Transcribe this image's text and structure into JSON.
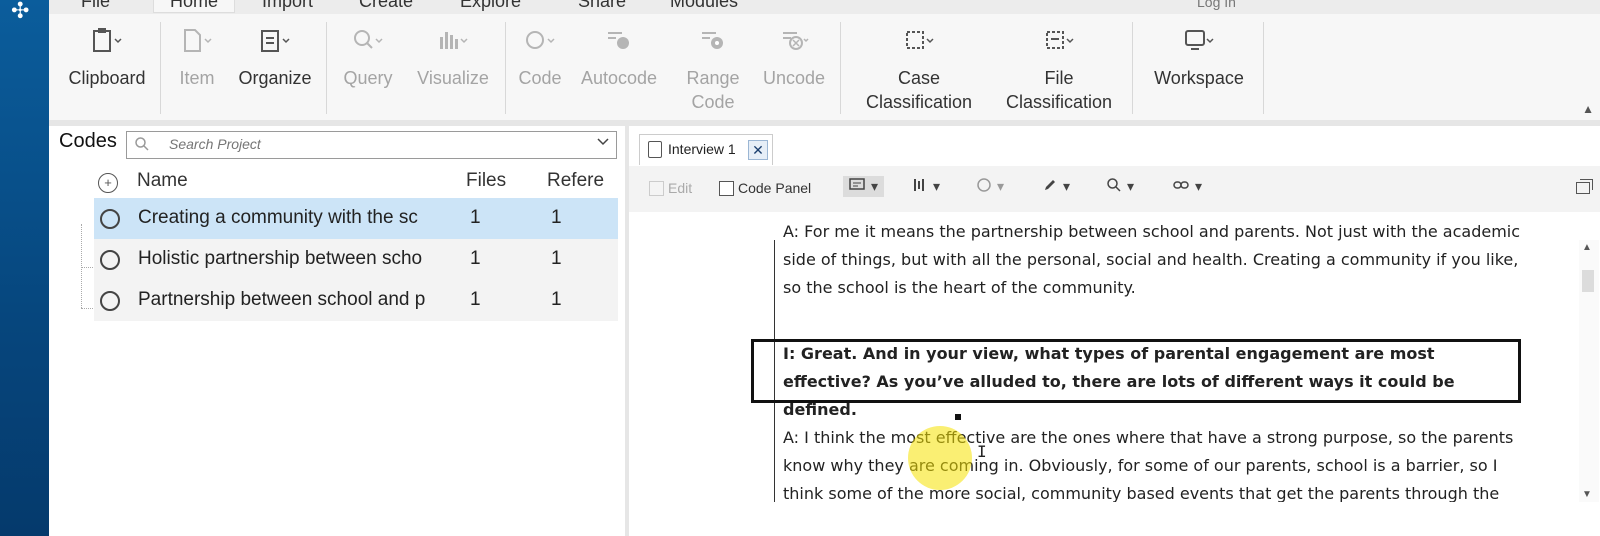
{
  "menu": {
    "items": [
      "File",
      "Home",
      "Import",
      "Create",
      "Explore",
      "Share",
      "Modules"
    ],
    "active": "Home",
    "login": "Log In"
  },
  "ribbon": {
    "groups": [
      {
        "label": "Clipboard",
        "icon": "clipboard-icon",
        "enabled": true
      },
      {
        "label": "Item",
        "icon": "item-icon",
        "enabled": false
      },
      {
        "label": "Organize",
        "icon": "organize-icon",
        "enabled": true
      },
      {
        "label": "Query",
        "icon": "query-icon",
        "enabled": false
      },
      {
        "label": "Visualize",
        "icon": "visualize-icon",
        "enabled": false
      },
      {
        "label": "Code",
        "icon": "code-icon",
        "enabled": false
      },
      {
        "label": "Autocode",
        "icon": "autocode-icon",
        "enabled": false
      },
      {
        "label": "Range Code",
        "icon": "range-code-icon",
        "enabled": false
      },
      {
        "label": "Uncode",
        "icon": "uncode-icon",
        "enabled": false
      },
      {
        "label": "Case Classification",
        "icon": "case-classification-icon",
        "enabled": true
      },
      {
        "label": "File Classification",
        "icon": "file-classification-icon",
        "enabled": true
      },
      {
        "label": "Workspace",
        "icon": "workspace-icon",
        "enabled": true
      }
    ]
  },
  "codes": {
    "title": "Codes",
    "search_placeholder": "Search Project",
    "columns": {
      "name": "Name",
      "files": "Files",
      "refs": "Refere"
    },
    "rows": [
      {
        "name": "Creating a community with the sc",
        "files": "1",
        "refs": "1",
        "selected": true
      },
      {
        "name": "Holistic partnership between scho",
        "files": "1",
        "refs": "1",
        "selected": false
      },
      {
        "name": "Partnership between school and p",
        "files": "1",
        "refs": "1",
        "selected": false
      }
    ]
  },
  "document": {
    "tab_label": "Interview 1",
    "toolbar": {
      "edit_label": "Edit",
      "code_panel_label": "Code Panel"
    },
    "paragraphs": [
      {
        "text": "A: For me it means the partnership between school and parents. Not just with the academic side of things, but with all the personal, social and health. Creating a community if you like, so the school is the heart of the community.",
        "bold": false
      },
      {
        "text": "I: Great. And in your view, what types of parental engagement are most effective? As you’ve alluded to, there are lots of different ways it could be defined.",
        "bold": true
      },
      {
        "text": "A: I think the most effective are the ones where that have a strong purpose, so the parents know why they are coming in. Obviously, for some of our parents, school is a barrier, so I think some of the more social, community based events that get the parents through the",
        "bold": false
      }
    ]
  },
  "colors": {
    "leftbar": "#0b5d9c",
    "selected_row": "#cce4f7",
    "click_highlight": "#f5e100"
  }
}
